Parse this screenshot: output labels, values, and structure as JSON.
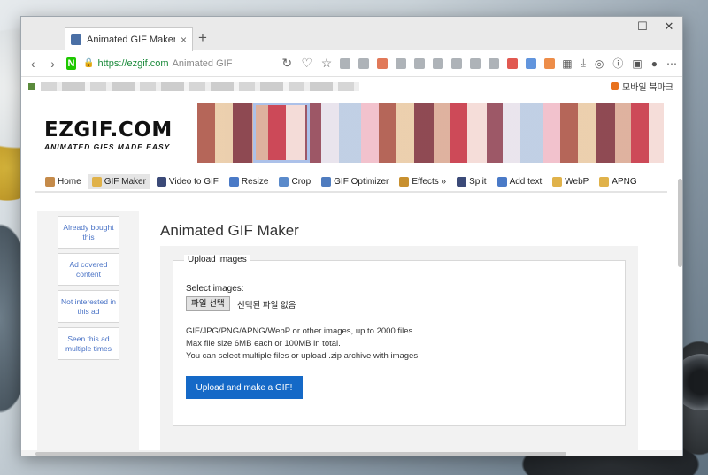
{
  "browser": {
    "tab_title": "Animated GIF Maker",
    "new_tab": "+",
    "tab_close": "×",
    "window_controls": [
      "–",
      "☐",
      "✕"
    ],
    "url": "https://ezgif.com",
    "url_suffix": "Animated GIF",
    "bookmarks_right": "모바일 북마크"
  },
  "site": {
    "logo": "EZGIF.COM",
    "tagline": "ANIMATED GIFS MADE EASY",
    "menu": [
      {
        "label": "Home",
        "icon": "home-icon"
      },
      {
        "label": "GIF Maker",
        "icon": "gif-maker-icon"
      },
      {
        "label": "Video to GIF",
        "icon": "video-icon"
      },
      {
        "label": "Resize",
        "icon": "resize-icon"
      },
      {
        "label": "Crop",
        "icon": "crop-icon"
      },
      {
        "label": "GIF Optimizer",
        "icon": "optimizer-icon"
      },
      {
        "label": "Effects »",
        "icon": "effects-icon"
      },
      {
        "label": "Split",
        "icon": "split-icon"
      },
      {
        "label": "Add text",
        "icon": "text-icon"
      },
      {
        "label": "WebP",
        "icon": "webp-icon"
      },
      {
        "label": "APNG",
        "icon": "apng-icon"
      }
    ],
    "ad_options": [
      "Already bought this",
      "Ad covered content",
      "Not interested in this ad",
      "Seen this ad multiple times"
    ],
    "page_title": "Animated GIF Maker",
    "upload": {
      "legend": "Upload images",
      "select_label": "Select images:",
      "file_button": "파일 선택",
      "file_status": "선택된 파일 없음",
      "info_lines": [
        "GIF/JPG/PNG/APNG/WebP or other images, up to 2000 files.",
        "Max file size 6MB each or 100MB in total.",
        "You can select multiple files or upload .zip archive with images."
      ],
      "submit": "Upload and make a GIF!"
    }
  },
  "colors": {
    "accent": "#1569c7",
    "link": "#4a73c6"
  }
}
